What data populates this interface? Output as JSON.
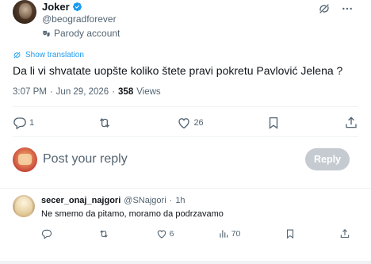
{
  "tweet": {
    "display_name": "Joker",
    "handle": "@beogradforever",
    "parody_label": "Parody account",
    "translate_label": "Show translation",
    "text": "Da li vi shvatate uopšte koliko štete pravi pokretu Pavlović Jelena ?",
    "time": "3:07 PM",
    "date": "Jun 29, 2026",
    "separator": "·",
    "views_count": "358",
    "views_label": "Views",
    "actions": {
      "replies": "1",
      "reposts": "",
      "likes": "26"
    }
  },
  "reply_box": {
    "placeholder": "Post your reply",
    "button_label": "Reply"
  },
  "comment": {
    "name": "secer_onaj_najgori",
    "handle": "@SNajgori",
    "separator": "·",
    "time": "1h",
    "text": "Ne smemo da pitamo, moramo da podrzavamo",
    "actions": {
      "replies": "",
      "reposts": "",
      "likes": "6",
      "views": "70"
    }
  },
  "colors": {
    "accent": "#1d9bf0",
    "muted": "#536471",
    "text": "#0f1419",
    "reply_button_disabled": "#c5cbd0",
    "divider": "#eff3f4"
  },
  "icons": {
    "verified": "verified-badge-icon",
    "grok": "grok-icon",
    "more": "more-icon",
    "translate": "translate-icon",
    "parody": "theater-masks-icon",
    "reply": "reply-icon",
    "repost": "repost-icon",
    "like": "heart-icon",
    "bookmark": "bookmark-icon",
    "share": "share-icon",
    "views": "views-chart-icon"
  }
}
